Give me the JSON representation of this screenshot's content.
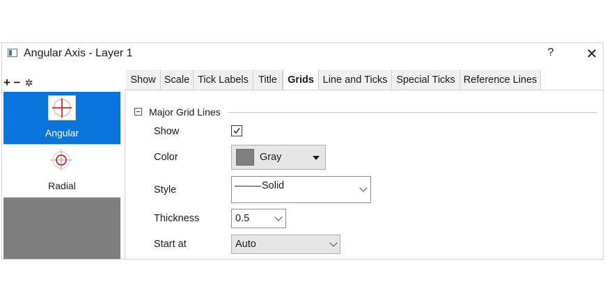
{
  "window": {
    "title": "Angular Axis - Layer 1",
    "help_label": "?",
    "close_label": "✕"
  },
  "mini_toolbar": {
    "add_label": "+",
    "remove_label": "−",
    "settings_icon": "gear-icon"
  },
  "sidebar": {
    "items": [
      {
        "label": "Angular",
        "selected": true,
        "icon": "angular-axis-icon"
      },
      {
        "label": "Radial",
        "selected": false,
        "icon": "radial-axis-icon"
      }
    ],
    "active_color": "#0a74da"
  },
  "tabs": [
    {
      "label": "Show",
      "active": false
    },
    {
      "label": "Scale",
      "active": false
    },
    {
      "label": "Tick Labels",
      "active": false
    },
    {
      "label": "Title",
      "active": false
    },
    {
      "label": "Grids",
      "active": true
    },
    {
      "label": "Line and Ticks",
      "active": false
    },
    {
      "label": "Special Ticks",
      "active": false
    },
    {
      "label": "Reference Lines",
      "active": false
    }
  ],
  "group": {
    "title": "Major Grid Lines",
    "expanded": true
  },
  "fields": {
    "show": {
      "label": "Show",
      "checked": true
    },
    "color": {
      "label": "Color",
      "value": "Gray",
      "swatch": "#808080"
    },
    "style": {
      "label": "Style",
      "value": "Solid"
    },
    "thickness": {
      "label": "Thickness",
      "value": "0.5"
    },
    "start_at": {
      "label": "Start at",
      "value": "Auto"
    }
  }
}
